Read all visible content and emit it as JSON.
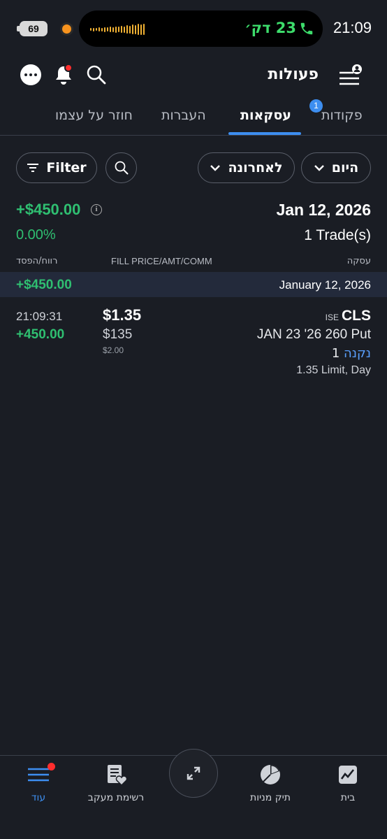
{
  "status_bar": {
    "battery": "69",
    "call_duration": "23 דק׳",
    "time": "21:09"
  },
  "header": {
    "title": "פעולות"
  },
  "tabs": [
    {
      "label": "פקודות",
      "badge": "1"
    },
    {
      "label": "עסקאות",
      "active": true
    },
    {
      "label": "העברות"
    },
    {
      "label": "חוזר על עצמו"
    }
  ],
  "filters": {
    "filter_label": "Filter",
    "recent_label": "לאחרונה",
    "today_label": "היום"
  },
  "summary": {
    "pnl": "+$450.00",
    "pnl_pct": "0.00%",
    "date": "Jan 12, 2026",
    "trade_count": "1 Trade(s)"
  },
  "columns": {
    "pnl": "רווח/הפסד",
    "fill": "FILL PRICE/AMT/COMM",
    "trade": "עסקה"
  },
  "day_group": {
    "pnl": "+$450.00",
    "date": "January 12, 2026"
  },
  "trade": {
    "time": "21:09:31",
    "pnl": "+450.00",
    "fill_price": "$1.35",
    "amount": "$135",
    "commission": "$2.00",
    "exchange": "ISE",
    "symbol": "CLS",
    "contract": "JAN 23 '26 260 Put",
    "side": "נקנה",
    "quantity": "1",
    "order_desc": "1.35 Limit, Day"
  },
  "bottom_nav": [
    {
      "label": "בית",
      "icon": "chart-icon"
    },
    {
      "label": "תיק מניות",
      "icon": "pie-chart-icon"
    },
    {
      "label": "",
      "icon": "expand-arrows-icon"
    },
    {
      "label": "רשימת מעקב",
      "icon": "watchlist-icon"
    },
    {
      "label": "עוד",
      "icon": "menu-icon",
      "active": true
    }
  ],
  "colors": {
    "background": "#1a1d24",
    "positive": "#2fbf71",
    "accent": "#3d8ef0",
    "alert": "#ff2d2d"
  }
}
